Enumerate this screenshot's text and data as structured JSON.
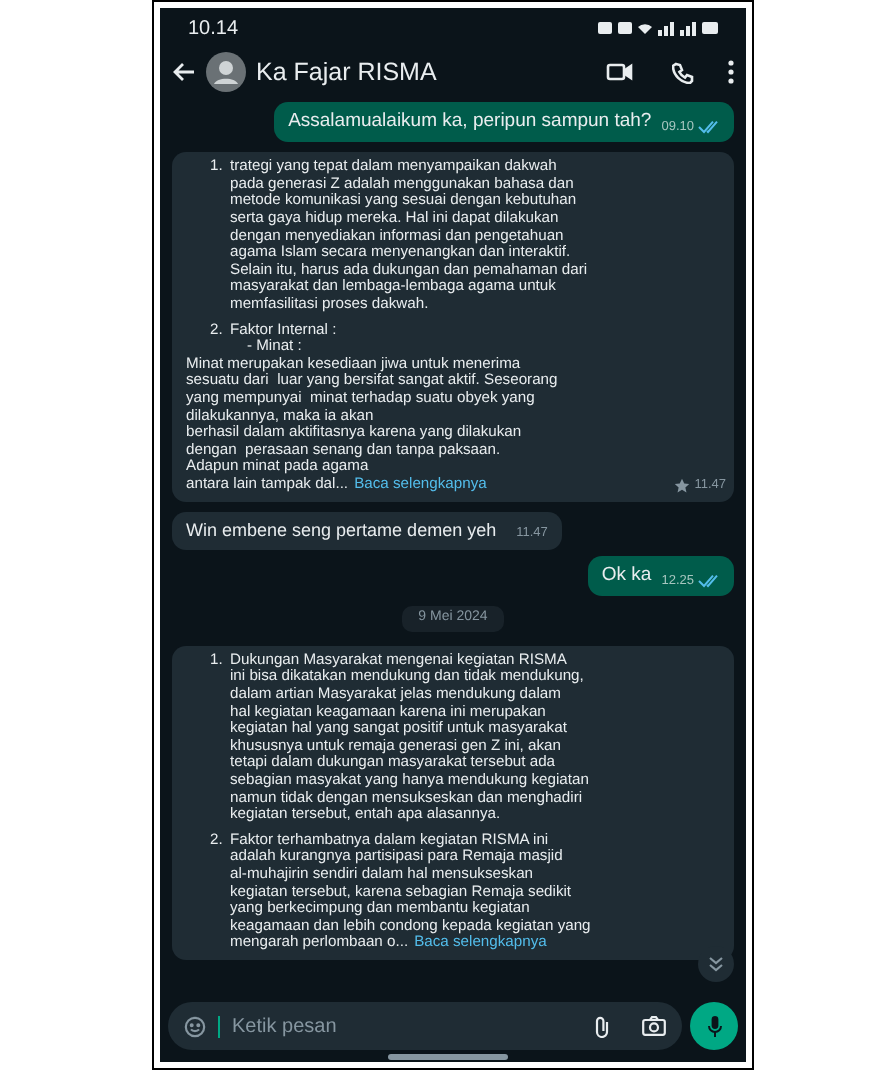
{
  "status_bar": {
    "time": "10.14"
  },
  "header": {
    "contact_name": "Ka Fajar RISMA"
  },
  "messages": [
    {
      "kind": "outgoing",
      "text": "Assalamualaikum ka, peripun sampun tah?",
      "time": "09.10",
      "read": true
    },
    {
      "kind": "incoming",
      "blocks": [
        {
          "kind": "numbered",
          "number": "1.",
          "text": "trategi yang tepat dalam menyampaikan dakwah\npada generasi Z adalah menggunakan bahasa dan\nmetode komunikasi yang sesuai dengan kebutuhan\nserta gaya hidup mereka. Hal ini dapat dilakukan\ndengan menyediakan informasi dan pengetahuan\nagama Islam secara menyenangkan dan interaktif.\nSelain itu, harus ada dukungan dan pemahaman dari\nmasyarakat dan lembaga-lembaga agama untuk\nmemfasilitasi proses dakwah."
        },
        {
          "kind": "numbered",
          "number": "2.",
          "text": "Faktor Internal :\n    - Minat :"
        },
        {
          "kind": "plain",
          "text": "Minat merupakan kesediaan jiwa untuk menerima\nsesuatu dari  luar yang bersifat sangat aktif. Seseorang\nyang mempunyai  minat terhadap suatu obyek yang\ndilakukannya, maka ia akan\nberhasil dalam aktifitasnya karena yang dilakukan\ndengan  perasaan senang dan tanpa paksaan.\nAdapun minat pada agama\nantara lain tampak dal..."
        }
      ],
      "more_link": "Baca selengkapnya",
      "starred": true,
      "time": "11.47"
    },
    {
      "kind": "incoming",
      "text": "Win embene seng pertame demen yeh",
      "time": "11.47"
    },
    {
      "kind": "outgoing",
      "text": "Ok ka",
      "time": "12.25",
      "read": true
    },
    {
      "kind": "date",
      "text": "9 Mei 2024"
    },
    {
      "kind": "incoming",
      "blocks": [
        {
          "kind": "numbered",
          "number": "1.",
          "text": "Dukungan Masyarakat mengenai kegiatan RISMA\nini bisa dikatakan mendukung dan tidak mendukung,\ndalam artian Masyarakat jelas mendukung dalam\nhal kegiatan keagamaan karena ini merupakan\nkegiatan hal yang sangat positif untuk masyarakat\nkhususnya untuk remaja generasi gen Z ini, akan\ntetapi dalam dukungan masyarakat tersebut ada\nsebagian masyakat yang hanya mendukung kegiatan\nnamun tidak dengan mensukseskan dan menghadiri\nkegiatan tersebut, entah apa alasannya."
        },
        {
          "kind": "numbered",
          "number": "2.",
          "text": "Faktor terhambatnya dalam kegiatan RISMA ini\nadalah kurangnya partisipasi para Remaja masjid\nal-muhajirin sendiri dalam hal mensukseskan\nkegiatan tersebut, karena sebagian Remaja sedikit\nyang berkecimpung dan membantu kegiatan\nkeagamaan dan lebih condong kepada kegiatan yang\nmengarah perlombaan o..."
        }
      ],
      "more_link": "Baca selengkapnya",
      "starred": false
    }
  ],
  "composer": {
    "placeholder": "Ketik pesan"
  }
}
